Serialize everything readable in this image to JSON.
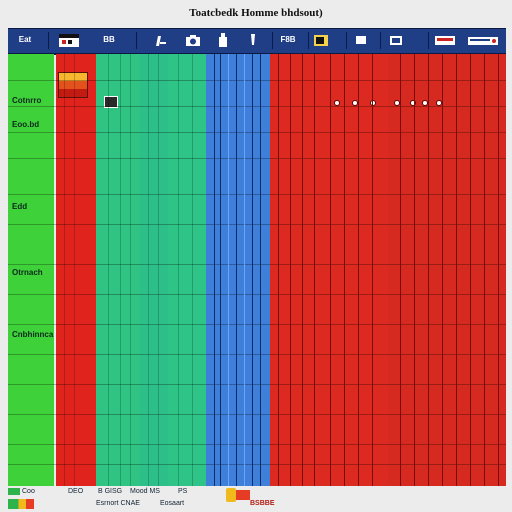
{
  "window": {
    "title": "Toatcbedk Homme bhdsout)"
  },
  "toolbar": {
    "items": [
      {
        "label": "Eat",
        "icon": ""
      },
      {
        "label": "",
        "icon": "calendar-icon"
      },
      {
        "label": "BB",
        "icon": ""
      },
      {
        "label": "",
        "icon": "pencil-icon"
      },
      {
        "label": "",
        "icon": "camera-icon"
      },
      {
        "label": "",
        "icon": "bottle-icon"
      },
      {
        "label": "",
        "icon": "pen-icon"
      },
      {
        "label": "F8B",
        "icon": ""
      },
      {
        "label": "",
        "icon": "folder-icon"
      },
      {
        "label": "",
        "icon": "monitor-icon"
      },
      {
        "label": "",
        "icon": "window-icon"
      },
      {
        "label": "",
        "icon": "device-icon"
      },
      {
        "label": "",
        "icon": "printer-icon"
      }
    ]
  },
  "sidebar": {
    "labels": [
      "Cotnrro",
      "Eoo.bd",
      "Edd",
      "Otrnach",
      "Cnbhinnca"
    ]
  },
  "columns": {
    "colors": [
      "#3fd13a",
      "#e1231d",
      "#2fc482",
      "#2dbf8a",
      "#2fc487",
      "#3e7fda",
      "#dc2a21",
      "#d6291f"
    ]
  },
  "status_bar": {
    "left_items": [
      "Coo",
      "DEO",
      "B GISG",
      "Mood MS",
      "PS"
    ],
    "bottom_items": [
      "Esrnort CNAE",
      "Eosaart",
      "BSBBE"
    ],
    "accent": "#e63b24"
  }
}
